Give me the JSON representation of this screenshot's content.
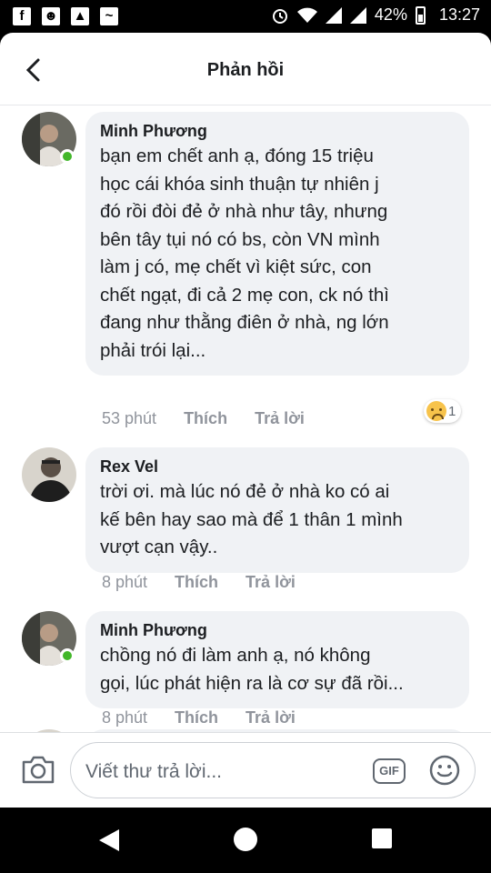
{
  "status_bar": {
    "icons": [
      "facebook-icon",
      "cat-icon",
      "image-icon",
      "activity-icon",
      "alarm-icon",
      "wifi-icon",
      "signal-icon",
      "signal-icon",
      "battery-icon"
    ],
    "battery": "42%",
    "time": "13:27"
  },
  "header": {
    "title": "Phản hồi"
  },
  "comments": [
    {
      "author": "Minh Phương",
      "text": "bạn em chết anh ạ, đóng 15 triệu\nhọc cái khóa sinh thuận tự nhiên j\nđó rồi đòi đẻ ở nhà như tây, nhưng\nbên tây tụi nó có bs, còn VN mình\nlàm j có, mẹ chết vì kiệt sức, con\nchết ngạt, đi cả 2 mẹ con, ck nó thì\nđang như thằng điên ở nhà, ng lớn\nphải trói lại...",
      "time": "53 phút",
      "like": "Thích",
      "reply": "Trả lời",
      "reaction_count": "1",
      "reaction_icon": "sad-icon",
      "online": true
    },
    {
      "author": "Rex Vel",
      "text": "trời ơi. mà lúc nó đẻ ở nhà ko có ai\nkế bên hay sao mà để 1 thân 1 mình\nvượt cạn vậy..",
      "time": "8 phút",
      "like": "Thích",
      "reply": "Trả lời",
      "online": false
    },
    {
      "author": "Minh Phương",
      "text": "chồng nó đi làm anh ạ, nó không\ngọi, lúc phát hiện ra là cơ sự đã rồi...",
      "time": "8 phút",
      "like": "Thích",
      "reply": "Trả lời",
      "online": true
    }
  ],
  "composer": {
    "placeholder": "Viết thư trả lời...",
    "gif_label": "GIF",
    "camera_icon": "camera-icon",
    "emoji_icon": "smiley-icon"
  },
  "colors": {
    "online": "#42b72a",
    "bubble": "#f0f2f5",
    "meta": "#90949c"
  }
}
